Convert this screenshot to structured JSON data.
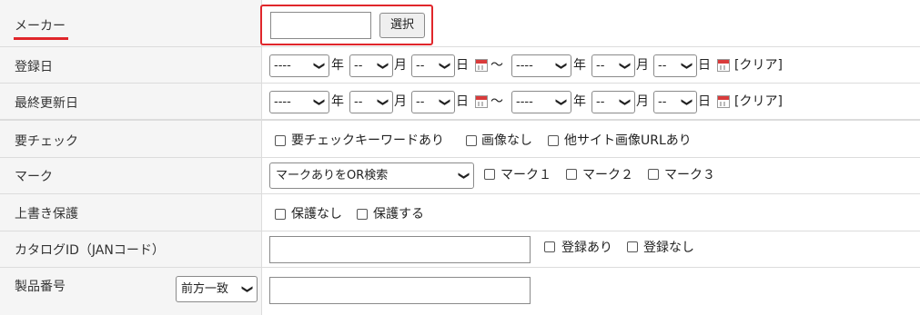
{
  "maker": {
    "label": "メーカー",
    "select_button": "選択",
    "input_value": ""
  },
  "registered": {
    "label": "登録日",
    "from": {
      "year": "----",
      "month": "--",
      "day": "--"
    },
    "to": {
      "year": "----",
      "month": "--",
      "day": "--"
    },
    "unit_year": "年",
    "unit_month": "月",
    "unit_day": "日",
    "tilde": "～",
    "clear": "[クリア]"
  },
  "updated": {
    "label": "最終更新日",
    "from": {
      "year": "----",
      "month": "--",
      "day": "--"
    },
    "to": {
      "year": "----",
      "month": "--",
      "day": "--"
    },
    "unit_year": "年",
    "unit_month": "月",
    "unit_day": "日",
    "tilde": "～",
    "clear": "[クリア]"
  },
  "check_needed": {
    "label": "要チェック",
    "options": [
      "要チェックキーワードあり",
      "画像なし",
      "他サイト画像URLあり"
    ]
  },
  "mark": {
    "label": "マーク",
    "mode_selected": "マークありをOR検索",
    "options": [
      "マーク１",
      "マーク２",
      "マーク３"
    ]
  },
  "overwrite": {
    "label": "上書き保護",
    "options": [
      "保護なし",
      "保護する"
    ]
  },
  "catalog": {
    "label": "カタログID（JANコード）",
    "input_value": "",
    "options": [
      "登録あり",
      "登録なし"
    ]
  },
  "product_no": {
    "label": "製品番号",
    "match_selected": "前方一致",
    "input_value": ""
  },
  "colors": {
    "highlight": "#e0262b",
    "label_bg": "#f5f5f5",
    "border": "#dcdcdc"
  }
}
